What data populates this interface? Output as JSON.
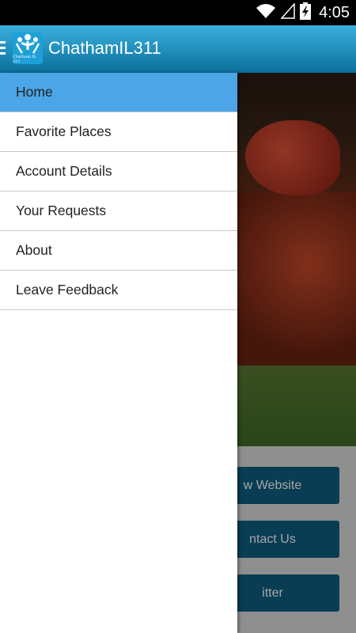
{
  "status_bar": {
    "time": "4:05",
    "icons": [
      "wifi-icon",
      "signal-icon",
      "battery-charging-icon"
    ]
  },
  "app_bar": {
    "title": "ChathamIL311",
    "logo_text": "Chatham IL 311",
    "menu_icon": "menu-icon"
  },
  "drawer": {
    "items": [
      {
        "label": "Home",
        "active": true
      },
      {
        "label": "Favorite Places",
        "active": false
      },
      {
        "label": "Account Details",
        "active": false
      },
      {
        "label": "Your Requests",
        "active": false
      },
      {
        "label": "About",
        "active": false
      },
      {
        "label": "Leave Feedback",
        "active": false
      }
    ],
    "active_color": "#4ba5e6"
  },
  "background": {
    "buttons": [
      {
        "label": "w Website"
      },
      {
        "label": "ntact Us"
      },
      {
        "label": "itter"
      }
    ]
  },
  "colors": {
    "appbar_top": "#3ab0de",
    "appbar_bottom": "#0b6f9b",
    "button": "#0e5f80"
  }
}
